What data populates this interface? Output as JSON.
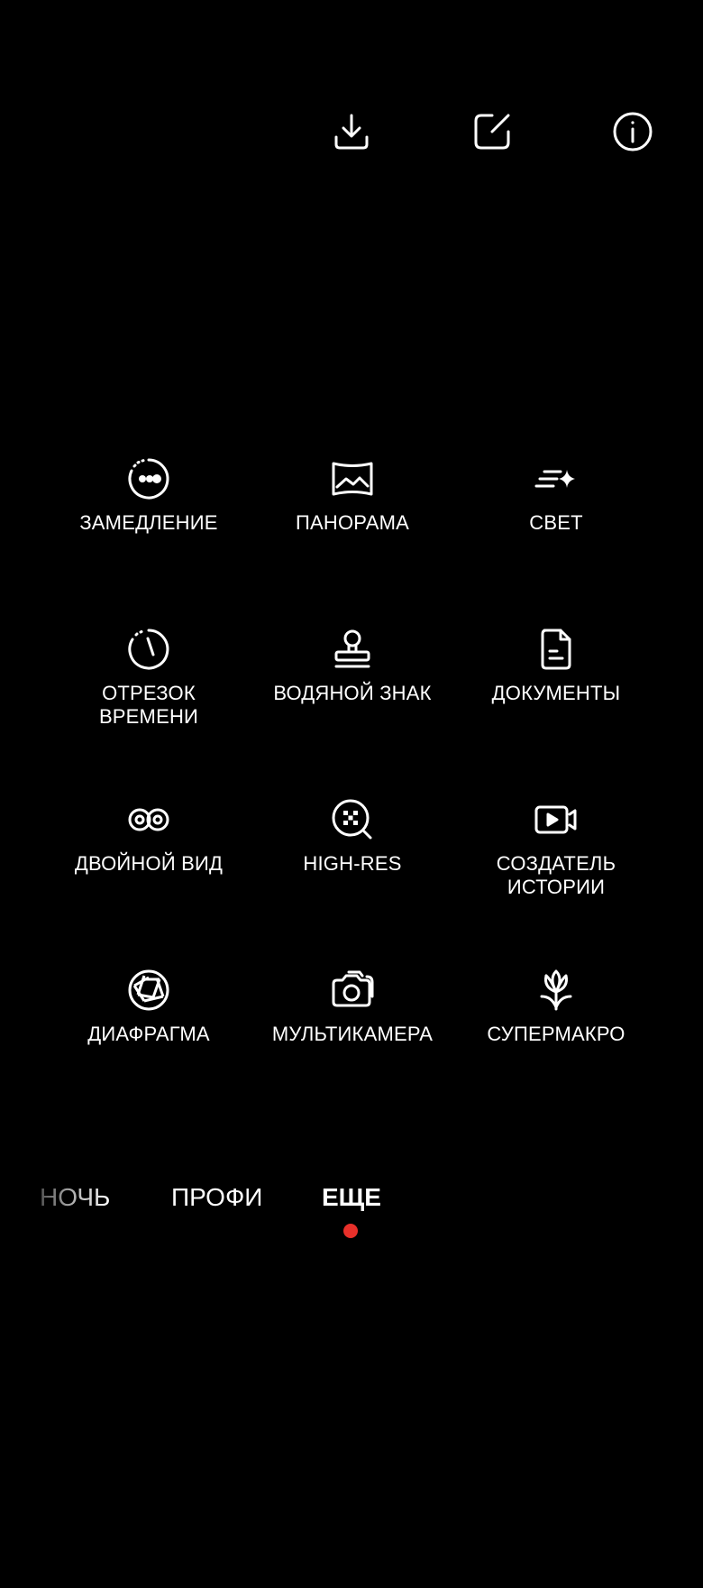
{
  "top_bar": {
    "icons": [
      "download-icon",
      "edit-icon",
      "info-icon"
    ]
  },
  "modes": [
    {
      "label": "ЗАМЕДЛЕНИЕ",
      "icon": "slow-motion-icon"
    },
    {
      "label": "ПАНОРАМА",
      "icon": "panorama-icon"
    },
    {
      "label": "СВЕТ",
      "icon": "light-icon"
    },
    {
      "label": "ОТРЕЗОК\nВРЕМЕНИ",
      "icon": "timelapse-icon"
    },
    {
      "label": "ВОДЯНОЙ ЗНАК",
      "icon": "watermark-stamp-icon"
    },
    {
      "label": "ДОКУМЕНТЫ",
      "icon": "document-icon"
    },
    {
      "label": "ДВОЙНОЙ ВИД",
      "icon": "dual-view-icon"
    },
    {
      "label": "HIGH-RES",
      "icon": "high-res-icon"
    },
    {
      "label": "СОЗДАТЕЛЬ\nИСТОРИИ",
      "icon": "story-creator-icon"
    },
    {
      "label": "ДИАФРАГМА",
      "icon": "aperture-icon"
    },
    {
      "label": "МУЛЬТИКАМЕРА",
      "icon": "multi-camera-icon"
    },
    {
      "label": "СУПЕРМАКРО",
      "icon": "super-macro-icon"
    }
  ],
  "tabs": {
    "night": "НОЧЬ",
    "pro": "ПРОФИ",
    "more": "ЕЩЕ",
    "active": "more"
  },
  "colors": {
    "background": "#000000",
    "text": "#ffffff",
    "active_indicator": "#e8302a"
  }
}
